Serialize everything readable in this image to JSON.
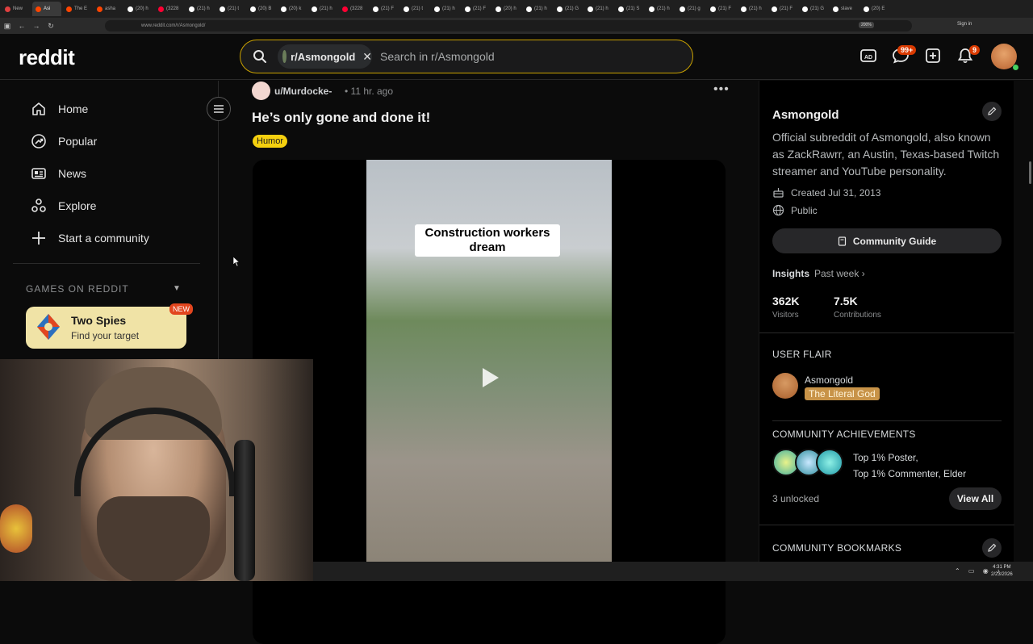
{
  "browser": {
    "tabs": [
      {
        "label": "New",
        "color": "#e04040"
      },
      {
        "label": "Asi",
        "color": "#ff4500",
        "active": true
      },
      {
        "label": "The E",
        "color": "#ff4500"
      },
      {
        "label": "asha",
        "color": "#ff4500"
      },
      {
        "label": "(20) h",
        "color": "#ffffff"
      },
      {
        "label": "(3228",
        "color": "#ff0033"
      },
      {
        "label": "(21) h",
        "color": "#ffffff"
      },
      {
        "label": "(21) t",
        "color": "#ffffff"
      },
      {
        "label": "(20) B",
        "color": "#ffffff"
      },
      {
        "label": "(20) k",
        "color": "#ffffff"
      },
      {
        "label": "(21) h",
        "color": "#ffffff"
      },
      {
        "label": "(3228",
        "color": "#ff0033"
      },
      {
        "label": "(21) F",
        "color": "#ffffff"
      },
      {
        "label": "(21) t",
        "color": "#ffffff"
      },
      {
        "label": "(21) h",
        "color": "#ffffff"
      },
      {
        "label": "(21) F",
        "color": "#ffffff"
      },
      {
        "label": "(20) h",
        "color": "#ffffff"
      },
      {
        "label": "(21) h",
        "color": "#ffffff"
      },
      {
        "label": "(21) G",
        "color": "#ffffff"
      },
      {
        "label": "(21) h",
        "color": "#ffffff"
      },
      {
        "label": "(21) S",
        "color": "#ffffff"
      },
      {
        "label": "(21) h",
        "color": "#ffffff"
      },
      {
        "label": "(21) g",
        "color": "#ffffff"
      },
      {
        "label": "(21) F",
        "color": "#ffffff"
      },
      {
        "label": "(21) h",
        "color": "#ffffff"
      },
      {
        "label": "(21) F",
        "color": "#ffffff"
      },
      {
        "label": "(21) G",
        "color": "#ffffff"
      },
      {
        "label": "slave",
        "color": "#ffffff"
      },
      {
        "label": "(20) E",
        "color": "#ffffff"
      }
    ],
    "url": "www.reddit.com/r/Asmongold/",
    "zoom": "200%",
    "signin": "Sign in"
  },
  "header": {
    "logo": "reddit",
    "search_chip": "r/Asmongold",
    "search_placeholder": "Search in r/Asmongold",
    "chat_badge": "99+",
    "notif_badge": "9",
    "accent": "#c9a100"
  },
  "leftnav": {
    "items": [
      {
        "label": "Home",
        "icon": "home-icon"
      },
      {
        "label": "Popular",
        "icon": "popular-icon"
      },
      {
        "label": "News",
        "icon": "news-icon"
      },
      {
        "label": "Explore",
        "icon": "explore-icon"
      },
      {
        "label": "Start a community",
        "icon": "plus-icon"
      }
    ],
    "games_heading": "GAMES ON REDDIT",
    "game": {
      "title": "Two Spies",
      "subtitle": "Find your target",
      "badge": "NEW"
    }
  },
  "post": {
    "author": "u/Murdocke-",
    "time": "• 11 hr. ago",
    "title": "He’s only gone and done it!",
    "flair": "Humor",
    "flair_color": "#f5d00f",
    "video_caption": "Construction workers dream"
  },
  "sidebar": {
    "name": "Asmongold",
    "description": "Official subreddit of Asmongold, also known as ZackRawrr, an Austin, Texas-based Twitch streamer and YouTube personality.",
    "created": "Created Jul 31, 2013",
    "visibility": "Public",
    "guide_label": "Community Guide",
    "insights_label": "Insights",
    "insights_period": "Past week",
    "stats": [
      {
        "value": "362K",
        "label": "Visitors"
      },
      {
        "value": "7.5K",
        "label": "Contributions"
      }
    ],
    "user_flair_heading": "USER FLAIR",
    "flair_user": "Asmongold",
    "flair_tag": "The Literal God",
    "achievements_heading": "COMMUNITY ACHIEVEMENTS",
    "achievements_line1": "Top 1% Poster,",
    "achievements_line2": "Top 1% Commenter, Elder",
    "unlocked": "3 unlocked",
    "view_all": "View All",
    "bookmarks_heading": "COMMUNITY BOOKMARKS"
  },
  "taskbar": {
    "time": "4:31 PM",
    "date": "2/23/2026"
  }
}
